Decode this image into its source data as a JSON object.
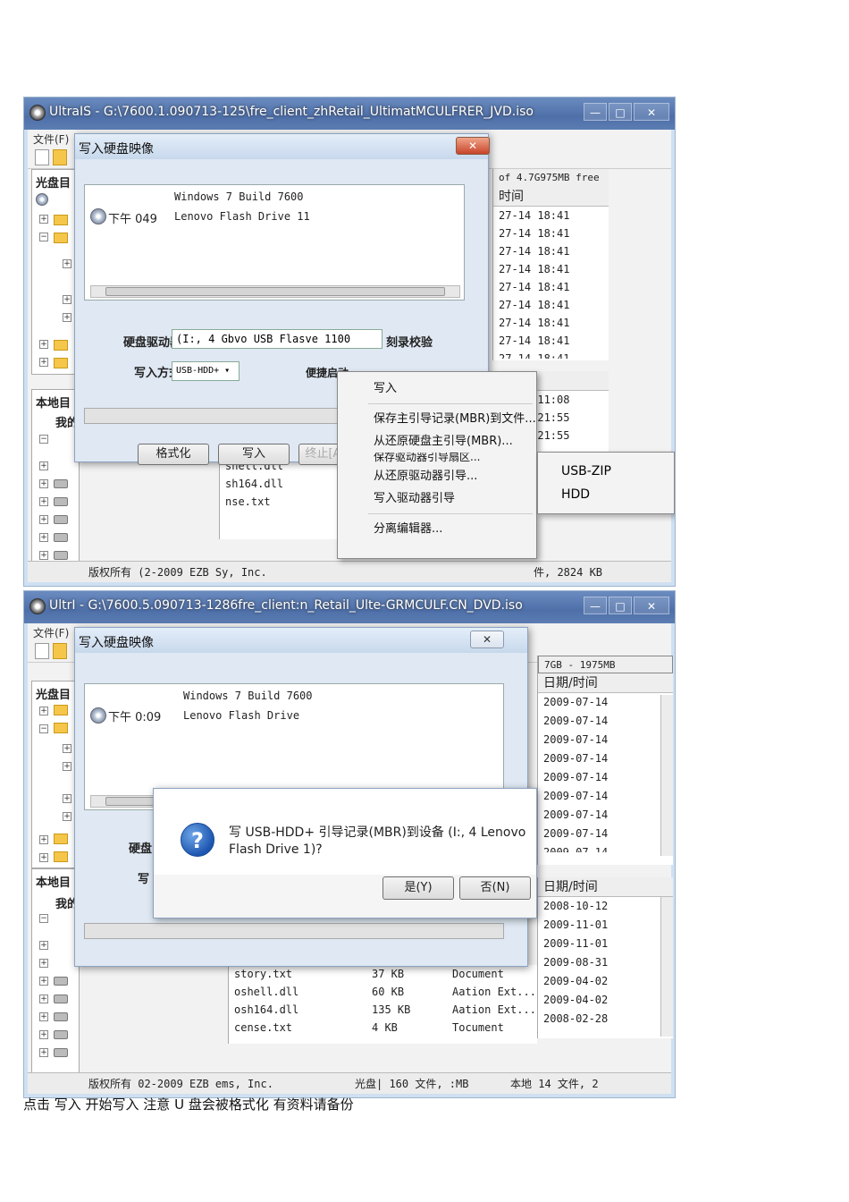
{
  "shot1": {
    "window_title": "UltraIS - G:\\7600.1.090713-125\\fre_client_zhRetail_UltimatMCULFRER_JVD.iso",
    "menu_file": "文件(F)",
    "left_label_disc": "光盘目",
    "left_label_local": "本地目",
    "left_label_my": "我的",
    "free_space": "of 4.7G975MB free",
    "time_header": "时间",
    "time_rows": [
      "27-14 18:41",
      "27-14 18:41",
      "27-14 18:41",
      "27-14 18:41",
      "27-14 18:41",
      "27-14 18:41",
      "27-14 18:41",
      "27-14 18:41",
      "27-14 18:41"
    ],
    "time_header_2": "时间",
    "time_rows_2": [
      "10-12 11:08",
      "11-01 21:55",
      "11-01 21:55"
    ],
    "files": [
      "shell.dll",
      "sh164.dll",
      "nse.txt"
    ],
    "status": "版权所有 (2-2009 EZB Sy, Inc.",
    "status_right": "件, 2824 KB",
    "dialog": {
      "title": "写入硬盘映像",
      "msg_line1": "Windows 7 Build 7600",
      "msg_time": "下午 049",
      "msg_line2": "Lenovo  Flash Drive 11",
      "drive_label": "硬盘驱动器:",
      "drive_value": "(I:, 4 Gbvo  USB Flasve 1100",
      "verify_label": "刻录校验",
      "method_label": "写入方式:",
      "method_value": "USB-HDD+ ▾",
      "quick_boot": "便捷启动",
      "btn_format": "格式化",
      "btn_write": "写入",
      "btn_stop": "终止[A]"
    },
    "context_menu": {
      "items": [
        "写入",
        "保存主引导记录(MBR)到文件...",
        "从还原硬盘主引导(MBR)...",
        "保存驱动器引导扇区...",
        "从还原驱动器引导...",
        "写入驱动器引导",
        "分离编辑器..."
      ]
    },
    "submenu": [
      "USB-ZIP",
      "HDD"
    ]
  },
  "shot2": {
    "window_title": "UltrI - G:\\7600.5.090713-1286fre_client:n_Retail_Ulte-GRMCULF.CN_DVD.iso",
    "menu_file": "文件(F)",
    "left_label_disc": "光盘目",
    "left_label_local": "本地目",
    "left_label_my": "我的",
    "size_info": "7GB - 1975MB",
    "date_header": "日期/时间",
    "date_rows": [
      "2009-07-14",
      "2009-07-14",
      "2009-07-14",
      "2009-07-14",
      "2009-07-14",
      "2009-07-14",
      "2009-07-14",
      "2009-07-14",
      "2009-07-14"
    ],
    "date_header_2": "日期/时间",
    "date_rows_2": [
      "2008-10-12",
      "2009-11-01",
      "2009-11-01",
      "2009-08-31",
      "2009-04-02",
      "2009-04-02",
      "2008-02-28"
    ],
    "files": [
      {
        "name": "story.txt",
        "size": "37 KB",
        "type": "Document"
      },
      {
        "name": "oshell.dll",
        "size": "60 KB",
        "type": "Aation Ext..."
      },
      {
        "name": "osh164.dll",
        "size": "135 KB",
        "type": "Aation Ext..."
      },
      {
        "name": "cense.txt",
        "size": "4 KB",
        "type": "Tocument"
      }
    ],
    "status": "版权所有 02-2009 EZB ems, Inc.",
    "status_mid": "光盘| 160 文件, :MB",
    "status_right": "本地 14 文件, 2",
    "dialog": {
      "title": "写入硬盘映像",
      "msg_line1": "Windows 7 Build 7600",
      "msg_time": "下午 0:09",
      "msg_line2": "Lenovo Flash Drive",
      "drive_label": "硬盘",
      "method_label": "写"
    },
    "confirm": {
      "text_line1": "写 USB-HDD+ 引导记录(MBR)到设备 (I:, 4 Lenovo",
      "text_line2": "Flash Drive 1)?",
      "btn_yes": "是(Y)",
      "btn_no": "否(N)"
    }
  },
  "caption": "点击 写入 开始写入 注意 U 盘会被格式化 有资料请备份"
}
